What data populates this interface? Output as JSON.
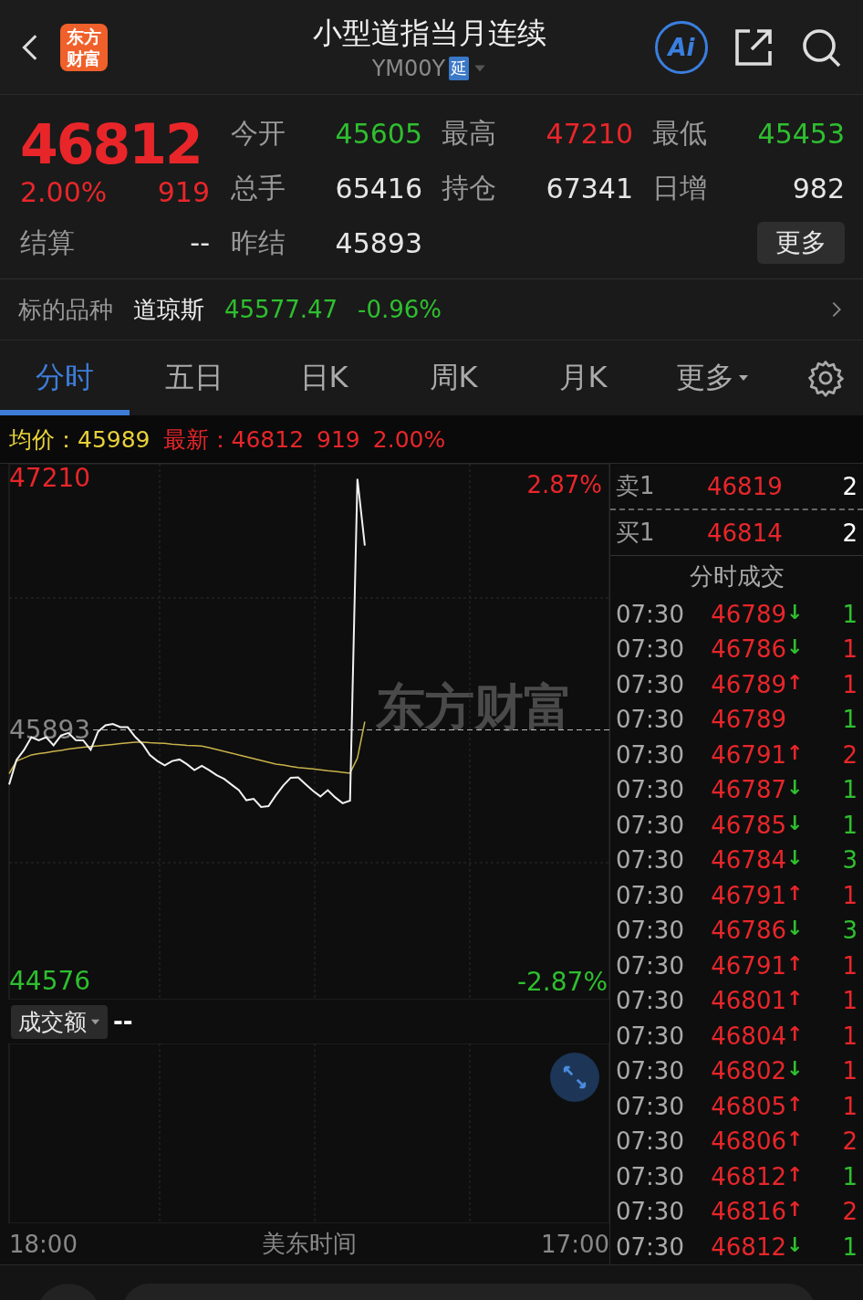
{
  "header": {
    "logo": "东方财富",
    "title": "小型道指当月连续",
    "code": "YM00Y",
    "delay_badge": "延",
    "ai_button": "Ai"
  },
  "quote": {
    "price": "46812",
    "change_pct": "2.00%",
    "change": "919",
    "settle_label": "结算",
    "settle_value": "--",
    "stats": [
      {
        "label": "今开",
        "value": "45605",
        "color": "#2fbf2f"
      },
      {
        "label": "最高",
        "value": "47210",
        "color": "#e8262a"
      },
      {
        "label": "最低",
        "value": "45453",
        "color": "#2fbf2f"
      },
      {
        "label": "总手",
        "value": "65416",
        "color": "#e6e6e6"
      },
      {
        "label": "持仓",
        "value": "67341",
        "color": "#e6e6e6"
      },
      {
        "label": "日增",
        "value": "982",
        "color": "#e6e6e6"
      },
      {
        "label": "昨结",
        "value": "45893",
        "color": "#e6e6e6"
      }
    ],
    "more_button": "更多"
  },
  "underlying": {
    "label": "标的品种",
    "name": "道琼斯",
    "value": "45577.47",
    "change_pct": "-0.96%"
  },
  "tabs": [
    {
      "label": "分时",
      "selected": true,
      "kind": "tab"
    },
    {
      "label": "五日",
      "selected": false,
      "kind": "tab"
    },
    {
      "label": "日K",
      "selected": false,
      "kind": "tab"
    },
    {
      "label": "周K",
      "selected": false,
      "kind": "tab"
    },
    {
      "label": "月K",
      "selected": false,
      "kind": "tab"
    },
    {
      "label": "更多",
      "selected": false,
      "kind": "menu"
    }
  ],
  "info_line": {
    "avg_label": "均价：",
    "avg_value": "45989",
    "latest_label": "最新：",
    "latest_value": "46812",
    "change": "919",
    "change_pct": "2.00%"
  },
  "chart": {
    "high_pct": "2.87%",
    "low_pct": "-2.87%",
    "watermark": "东方财富",
    "volume_selector": "成交额",
    "volume_value": "--",
    "time_start": "18:00",
    "time_end": "17:00",
    "chart_data": {
      "type": "line",
      "xlabel": "美东时间",
      "ylim": [
        44478,
        47289
      ],
      "ref_lines": [
        {
          "axis": "y",
          "value": 45893
        }
      ],
      "categories": [
        null,
        null,
        null,
        null,
        null,
        null,
        null,
        null,
        null,
        null,
        null,
        null,
        null,
        null,
        null,
        null,
        null,
        null,
        null,
        null,
        null,
        null,
        null,
        null,
        null,
        null,
        null,
        null,
        null,
        null,
        null,
        null,
        null,
        null,
        null,
        null,
        null,
        null,
        null,
        null,
        null,
        null,
        null,
        null,
        null,
        null,
        null,
        null,
        null,
        null,
        null,
        null,
        null,
        null,
        null,
        null,
        null,
        null,
        null,
        null,
        null,
        null,
        null,
        null,
        null,
        null,
        null,
        null,
        null,
        null,
        null,
        null,
        null,
        null,
        null,
        null,
        null,
        null,
        null,
        null,
        null,
        null
      ],
      "yticks": [
        {
          "value": 47210,
          "label": "47210"
        },
        {
          "value": 45893,
          "label": "45893"
        },
        {
          "value": 44576,
          "label": "44576"
        }
      ],
      "series": [
        {
          "color": "#f2f2f2",
          "values": [
            45606,
            45735,
            45787,
            45855,
            45838,
            45855,
            45812,
            45864,
            45877,
            45839,
            45838,
            45788,
            45884,
            45917,
            45924,
            45908,
            45907,
            45857,
            45819,
            45761,
            45730,
            45707,
            45730,
            45738,
            45713,
            45682,
            45705,
            45682,
            45655,
            45636,
            45606,
            45577,
            45524,
            45531,
            45489,
            45493,
            45550,
            45602,
            45642,
            45644,
            45608,
            45573,
            45544,
            45577,
            45539,
            45508,
            45522,
            47210,
            46860,
            null,
            null,
            null,
            null,
            null,
            null,
            null,
            null,
            null,
            null,
            null,
            null,
            null,
            null,
            null,
            null,
            null,
            null,
            null,
            null,
            null,
            null,
            null,
            null,
            null,
            null,
            null,
            null,
            null,
            null,
            null,
            null,
            null
          ]
        },
        {
          "color": "#c9b24a",
          "values": [
            45663,
            45730,
            45745,
            45762,
            45768,
            45774,
            45780,
            45786,
            45792,
            45798,
            45802,
            45806,
            45809,
            45813,
            45817,
            45821,
            45825,
            45829,
            45829,
            45826,
            45824,
            45822,
            45818,
            45815,
            45812,
            45810,
            45808,
            45800,
            45790,
            45780,
            45771,
            45761,
            45752,
            45742,
            45733,
            45723,
            45713,
            45708,
            45701,
            45696,
            45692,
            45688,
            45684,
            45679,
            45675,
            45671,
            45666,
            45745,
            45936,
            null,
            null,
            null,
            null,
            null,
            null,
            null,
            null,
            null,
            null,
            null,
            null,
            null,
            null,
            null,
            null,
            null,
            null,
            null,
            null,
            null,
            null,
            null,
            null,
            null,
            null,
            null,
            null,
            null,
            null,
            null,
            null,
            null
          ]
        }
      ]
    }
  },
  "order_book": [
    {
      "label": "卖1",
      "price": "46819",
      "volume": "2"
    },
    {
      "label": "买1",
      "price": "46814",
      "volume": "2"
    }
  ],
  "trades_title": "分时成交",
  "trades": [
    {
      "time": "07:30",
      "price": "46789",
      "arrow": "↓",
      "volume": "1",
      "color": "#2fbf2f"
    },
    {
      "time": "07:30",
      "price": "46786",
      "arrow": "↓",
      "volume": "1",
      "color": "#e8262a"
    },
    {
      "time": "07:30",
      "price": "46789",
      "arrow": "↑",
      "volume": "1",
      "color": "#e8262a"
    },
    {
      "time": "07:30",
      "price": "46789",
      "volume": "1",
      "color": "#2fbf2f"
    },
    {
      "time": "07:30",
      "price": "46791",
      "arrow": "↑",
      "volume": "2",
      "color": "#e8262a"
    },
    {
      "time": "07:30",
      "price": "46787",
      "arrow": "↓",
      "volume": "1",
      "color": "#2fbf2f"
    },
    {
      "time": "07:30",
      "price": "46785",
      "arrow": "↓",
      "volume": "1",
      "color": "#2fbf2f"
    },
    {
      "time": "07:30",
      "price": "46784",
      "arrow": "↓",
      "volume": "3",
      "color": "#2fbf2f"
    },
    {
      "time": "07:30",
      "price": "46791",
      "arrow": "↑",
      "volume": "1",
      "color": "#e8262a"
    },
    {
      "time": "07:30",
      "price": "46786",
      "arrow": "↓",
      "volume": "3",
      "color": "#2fbf2f"
    },
    {
      "time": "07:30",
      "price": "46791",
      "arrow": "↑",
      "volume": "1",
      "color": "#e8262a"
    },
    {
      "time": "07:30",
      "price": "46801",
      "arrow": "↑",
      "volume": "1",
      "color": "#e8262a"
    },
    {
      "time": "07:30",
      "price": "46804",
      "arrow": "↑",
      "volume": "1",
      "color": "#e8262a"
    },
    {
      "time": "07:30",
      "price": "46802",
      "arrow": "↓",
      "volume": "1",
      "color": "#e8262a"
    },
    {
      "time": "07:30",
      "price": "46805",
      "arrow": "↑",
      "volume": "1",
      "color": "#e8262a"
    },
    {
      "time": "07:30",
      "price": "46806",
      "arrow": "↑",
      "volume": "2",
      "color": "#e8262a"
    },
    {
      "time": "07:30",
      "price": "46812",
      "arrow": "↑",
      "volume": "1",
      "color": "#2fbf2f"
    },
    {
      "time": "07:30",
      "price": "46816",
      "arrow": "↑",
      "volume": "2",
      "color": "#e8262a"
    },
    {
      "time": "07:30",
      "price": "46812",
      "arrow": "↓",
      "volume": "1",
      "color": "#2fbf2f"
    }
  ]
}
